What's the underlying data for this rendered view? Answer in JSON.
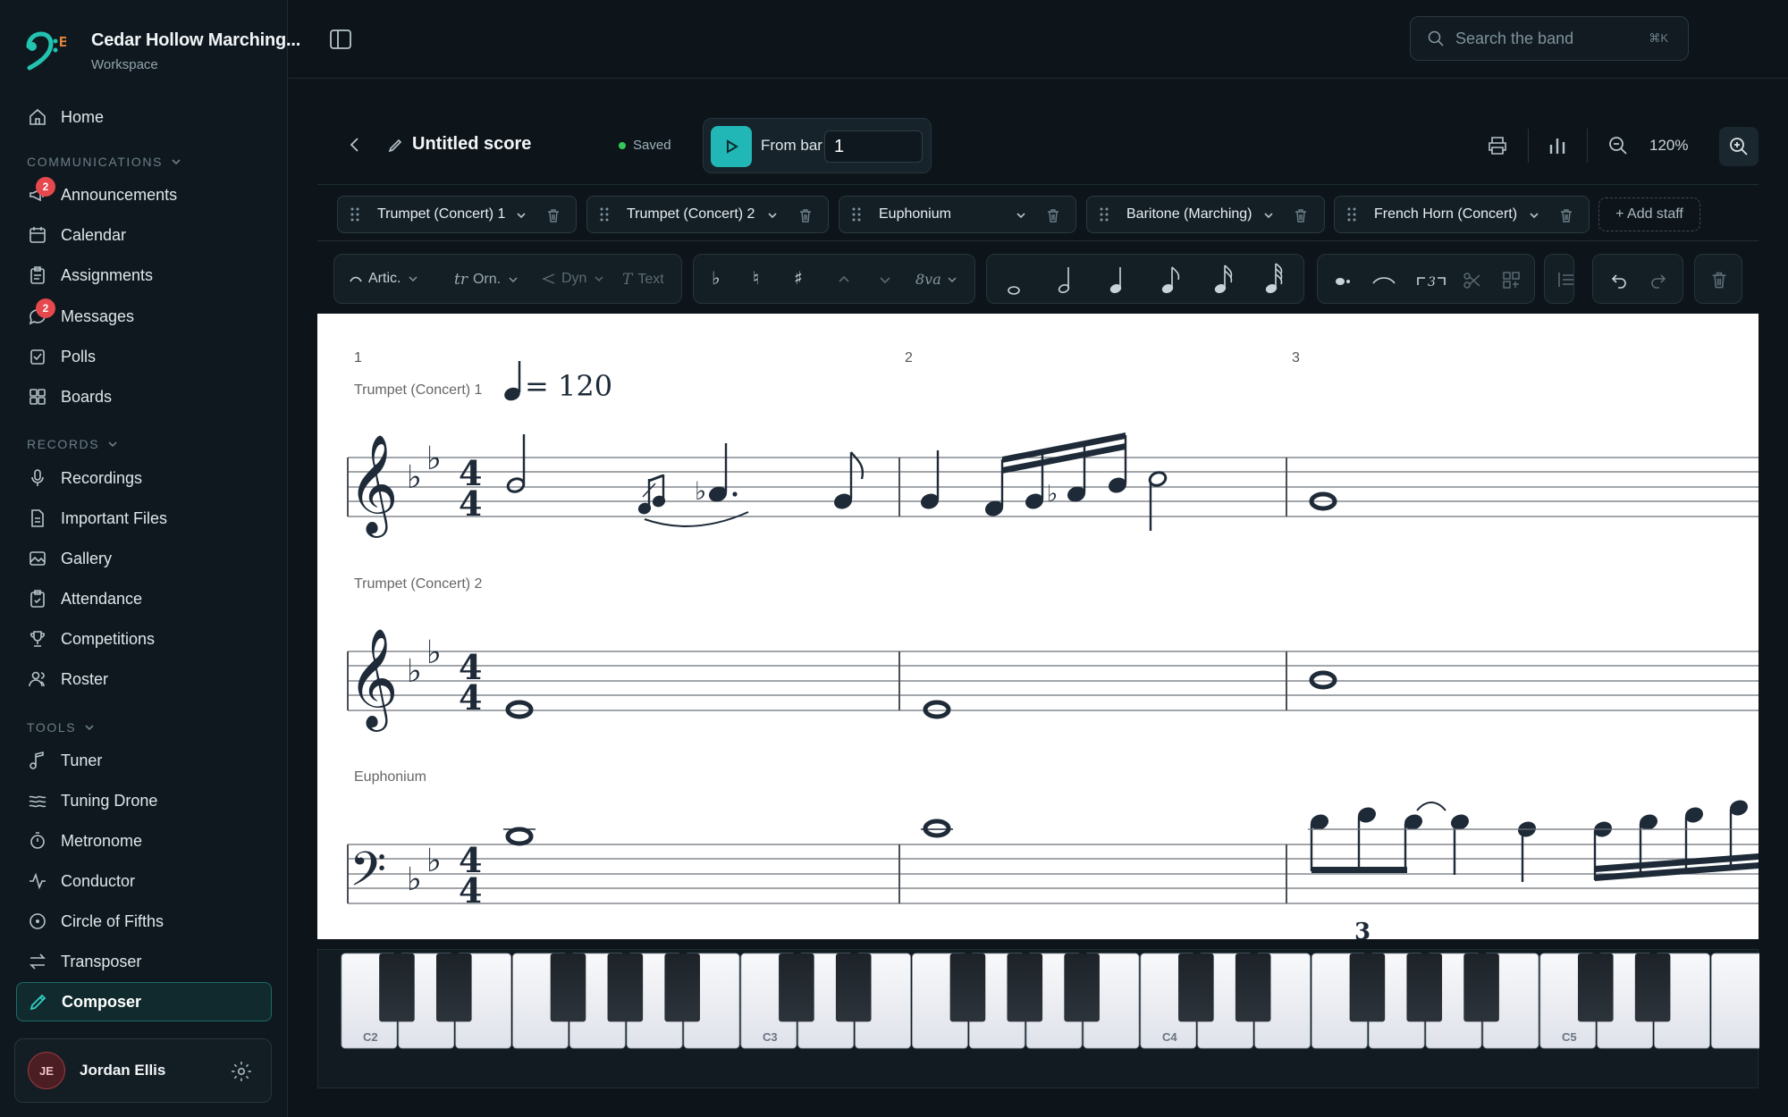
{
  "sidebar": {
    "brand": {
      "name": "Cedar Hollow Marching...",
      "sub": "Workspace"
    },
    "items": [
      {
        "label": "Home",
        "icon": "home-icon"
      },
      {
        "label": "Announcements",
        "icon": "megaphone-icon",
        "badge": "2"
      },
      {
        "label": "Calendar",
        "icon": "calendar-icon"
      },
      {
        "label": "Assignments",
        "icon": "clipboard-icon"
      },
      {
        "label": "Messages",
        "icon": "chat-icon",
        "badge": "2"
      },
      {
        "label": "Polls",
        "icon": "poll-icon"
      },
      {
        "label": "Boards",
        "icon": "boards-icon"
      },
      {
        "label": "Recordings",
        "icon": "mic-icon"
      },
      {
        "label": "Important Files",
        "icon": "file-icon"
      },
      {
        "label": "Gallery",
        "icon": "gallery-icon"
      },
      {
        "label": "Attendance",
        "icon": "attendance-icon"
      },
      {
        "label": "Competitions",
        "icon": "trophy-icon"
      },
      {
        "label": "Roster",
        "icon": "users-icon"
      },
      {
        "label": "Tuner",
        "icon": "note-icon"
      },
      {
        "label": "Tuning Drone",
        "icon": "waves-icon"
      },
      {
        "label": "Metronome",
        "icon": "timer-icon"
      },
      {
        "label": "Conductor",
        "icon": "pulse-icon"
      },
      {
        "label": "Circle of Fifths",
        "icon": "circle-icon"
      },
      {
        "label": "Transposer",
        "icon": "swap-icon"
      },
      {
        "label": "Composer",
        "icon": "pen-icon",
        "active": true
      }
    ],
    "sections": {
      "communications": "COMMUNICATIONS",
      "records": "RECORDS",
      "tools": "TOOLS"
    },
    "user": {
      "initials": "JE",
      "name": "Jordan Ellis"
    }
  },
  "search": {
    "placeholder": "Search the band",
    "shortcut": "⌘K"
  },
  "score": {
    "title": "Untitled score",
    "status": "Saved",
    "from_bar_label": "From bar",
    "from_bar_value": "1",
    "zoom": "120%"
  },
  "staves": [
    {
      "name": "Trumpet (Concert) 1"
    },
    {
      "name": "Trumpet (Concert) 2"
    },
    {
      "name": "Euphonium"
    },
    {
      "name": "Baritone (Marching)"
    },
    {
      "name": "French Horn (Concert)"
    }
  ],
  "add_staff": "+ Add staff",
  "toolbar": {
    "artic": "Artic.",
    "orn": "Orn.",
    "dyn": "Dyn",
    "text": "Text",
    "ottava": "8va",
    "ornament_prefix": "tr",
    "text_prefix": "T"
  },
  "notation": {
    "measure_numbers": [
      "1",
      "2",
      "3"
    ],
    "tempo": "= 120",
    "staff_labels": [
      "Trumpet (Concert) 1",
      "Trumpet (Concert) 2",
      "Euphonium"
    ],
    "tuplet": "3"
  },
  "piano": {
    "labels": [
      "C2",
      "C3",
      "C4",
      "C5"
    ]
  },
  "colors": {
    "accent": "#21b7b7",
    "badge": "#e5484d",
    "bg": "#0d151b"
  }
}
